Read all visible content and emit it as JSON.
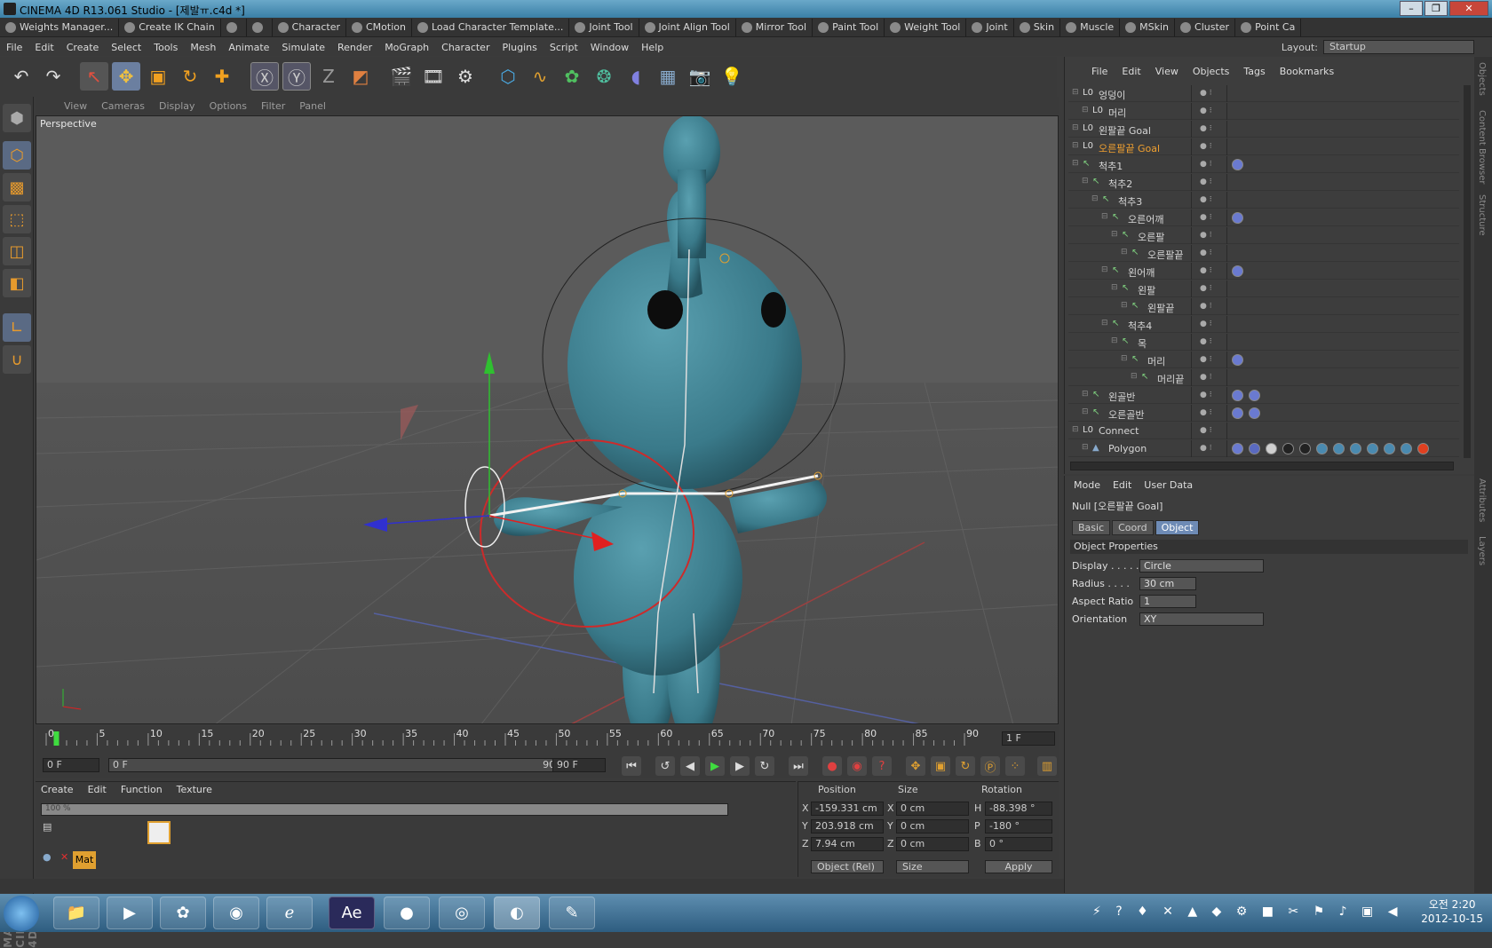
{
  "window": {
    "title": "CINEMA 4D R13.061 Studio - [제발ㅠ.c4d *]",
    "buttons": [
      "–",
      "❐",
      "✕"
    ]
  },
  "plugins": [
    {
      "label": "Weights Manager...",
      "enabled": true
    },
    {
      "label": "Create IK Chain",
      "enabled": true
    },
    {
      "label": "",
      "enabled": false
    },
    {
      "label": "",
      "enabled": false
    },
    {
      "label": "Character",
      "enabled": true
    },
    {
      "label": "CMotion",
      "enabled": true
    },
    {
      "label": "Load Character Template...",
      "enabled": true
    },
    {
      "label": "Joint Tool",
      "enabled": true
    },
    {
      "label": "Joint Align Tool",
      "enabled": true
    },
    {
      "label": "Mirror Tool",
      "enabled": true
    },
    {
      "label": "Paint Tool",
      "enabled": true
    },
    {
      "label": "Weight Tool",
      "enabled": true
    },
    {
      "label": "Joint",
      "enabled": true
    },
    {
      "label": "Skin",
      "enabled": true
    },
    {
      "label": "Muscle",
      "enabled": true
    },
    {
      "label": "MSkin",
      "enabled": true
    },
    {
      "label": "Cluster",
      "enabled": true
    },
    {
      "label": "Point Ca",
      "enabled": true
    }
  ],
  "menu": [
    "File",
    "Edit",
    "Create",
    "Select",
    "Tools",
    "Mesh",
    "Animate",
    "Simulate",
    "Render",
    "MoGraph",
    "Character",
    "Plugins",
    "Script",
    "Window",
    "Help"
  ],
  "layout": {
    "label": "Layout:",
    "value": "Startup"
  },
  "viewport": {
    "menu": [
      "View",
      "Cameras",
      "Display",
      "Options",
      "Filter",
      "Panel"
    ],
    "label": "Perspective"
  },
  "timeline": {
    "ticks": [
      "0",
      "5",
      "10",
      "15",
      "20",
      "25",
      "30",
      "35",
      "40",
      "45",
      "50",
      "55",
      "60",
      "65",
      "70",
      "75",
      "80",
      "85",
      "90"
    ],
    "current_frame_field": "1 F",
    "start_field": "0 F",
    "range_start": "0 F",
    "range_end": "90 F",
    "end_field": "90 F"
  },
  "material_manager": {
    "menu": [
      "Create",
      "Edit",
      "Function",
      "Texture"
    ],
    "zoom": "100 %",
    "material_name": "Mat"
  },
  "coordinates": {
    "headers": [
      "Position",
      "Size",
      "Rotation"
    ],
    "rows": [
      {
        "axis": "X",
        "pos": "-159.331 cm",
        "saxis": "X",
        "size": "0 cm",
        "raxis": "H",
        "rot": "-88.398 °"
      },
      {
        "axis": "Y",
        "pos": "203.918 cm",
        "saxis": "Y",
        "size": "0 cm",
        "raxis": "P",
        "rot": "-180 °"
      },
      {
        "axis": "Z",
        "pos": "7.94 cm",
        "saxis": "Z",
        "size": "0 cm",
        "raxis": "B",
        "rot": "0 °"
      }
    ],
    "mode_select": "Object (Rel)",
    "size_select": "Size",
    "apply": "Apply"
  },
  "object_manager": {
    "menu": [
      "File",
      "Edit",
      "View",
      "Objects",
      "Tags",
      "Bookmarks"
    ],
    "rows": [
      {
        "name": "엉덩이",
        "indent": 0,
        "type": "null",
        "selected": false,
        "tags": 0
      },
      {
        "name": "머리",
        "indent": 1,
        "type": "null",
        "selected": false,
        "tags": 0
      },
      {
        "name": "왼팔끝 Goal",
        "indent": 0,
        "type": "null",
        "selected": false,
        "tags": 0
      },
      {
        "name": "오른팔끝 Goal",
        "indent": 0,
        "type": "null",
        "selected": true,
        "tags": 0
      },
      {
        "name": "척추1",
        "indent": 0,
        "type": "joint",
        "selected": false,
        "tags": 1
      },
      {
        "name": "척추2",
        "indent": 1,
        "type": "joint",
        "selected": false,
        "tags": 0
      },
      {
        "name": "척추3",
        "indent": 2,
        "type": "joint",
        "selected": false,
        "tags": 0
      },
      {
        "name": "오른어깨",
        "indent": 3,
        "type": "joint",
        "selected": false,
        "tags": 1
      },
      {
        "name": "오른팔",
        "indent": 4,
        "type": "joint",
        "selected": false,
        "tags": 0
      },
      {
        "name": "오른팔끝",
        "indent": 5,
        "type": "joint",
        "selected": false,
        "tags": 0
      },
      {
        "name": "왼어깨",
        "indent": 3,
        "type": "joint",
        "selected": false,
        "tags": 1
      },
      {
        "name": "왼팔",
        "indent": 4,
        "type": "joint",
        "selected": false,
        "tags": 0
      },
      {
        "name": "왼팔끝",
        "indent": 5,
        "type": "joint",
        "selected": false,
        "tags": 0
      },
      {
        "name": "척추4",
        "indent": 3,
        "type": "joint",
        "selected": false,
        "tags": 0
      },
      {
        "name": "목",
        "indent": 4,
        "type": "joint",
        "selected": false,
        "tags": 0
      },
      {
        "name": "머리",
        "indent": 5,
        "type": "joint",
        "selected": false,
        "tags": 1
      },
      {
        "name": "머리끝",
        "indent": 6,
        "type": "joint",
        "selected": false,
        "tags": 0
      },
      {
        "name": "왼골반",
        "indent": 1,
        "type": "joint",
        "selected": false,
        "tags": 2
      },
      {
        "name": "오른골반",
        "indent": 1,
        "type": "joint",
        "selected": false,
        "tags": 2
      },
      {
        "name": "Connect",
        "indent": 0,
        "type": "null",
        "selected": false,
        "tags": 0
      },
      {
        "name": "Polygon",
        "indent": 1,
        "type": "polygon",
        "selected": false,
        "tags": 12
      }
    ]
  },
  "attributes": {
    "menu": [
      "Mode",
      "Edit",
      "User Data"
    ],
    "object_title": "Null [오른팔끝 Goal]",
    "tabs": [
      "Basic",
      "Coord",
      "Object"
    ],
    "active_tab": "Object",
    "section": "Object Properties",
    "props": [
      {
        "label": "Display . . . . .",
        "value": "Circle",
        "kind": "select"
      },
      {
        "label": "Radius . . . .",
        "value": "30 cm",
        "kind": "number"
      },
      {
        "label": "Aspect Ratio",
        "value": "1",
        "kind": "number"
      },
      {
        "label": "Orientation",
        "value": "XY",
        "kind": "select"
      }
    ]
  },
  "right_strip": [
    "Objects",
    "Content Browser",
    "Structure",
    "Attributes",
    "Layers"
  ],
  "branding": "MAXON CINEMA 4D",
  "taskbar": {
    "time": "오전 2:20",
    "date": "2012-10-15"
  },
  "colors": {
    "accent_selected": "#f0a030",
    "character": "#3f8191",
    "viewport_bg": "#5b5b5b"
  }
}
